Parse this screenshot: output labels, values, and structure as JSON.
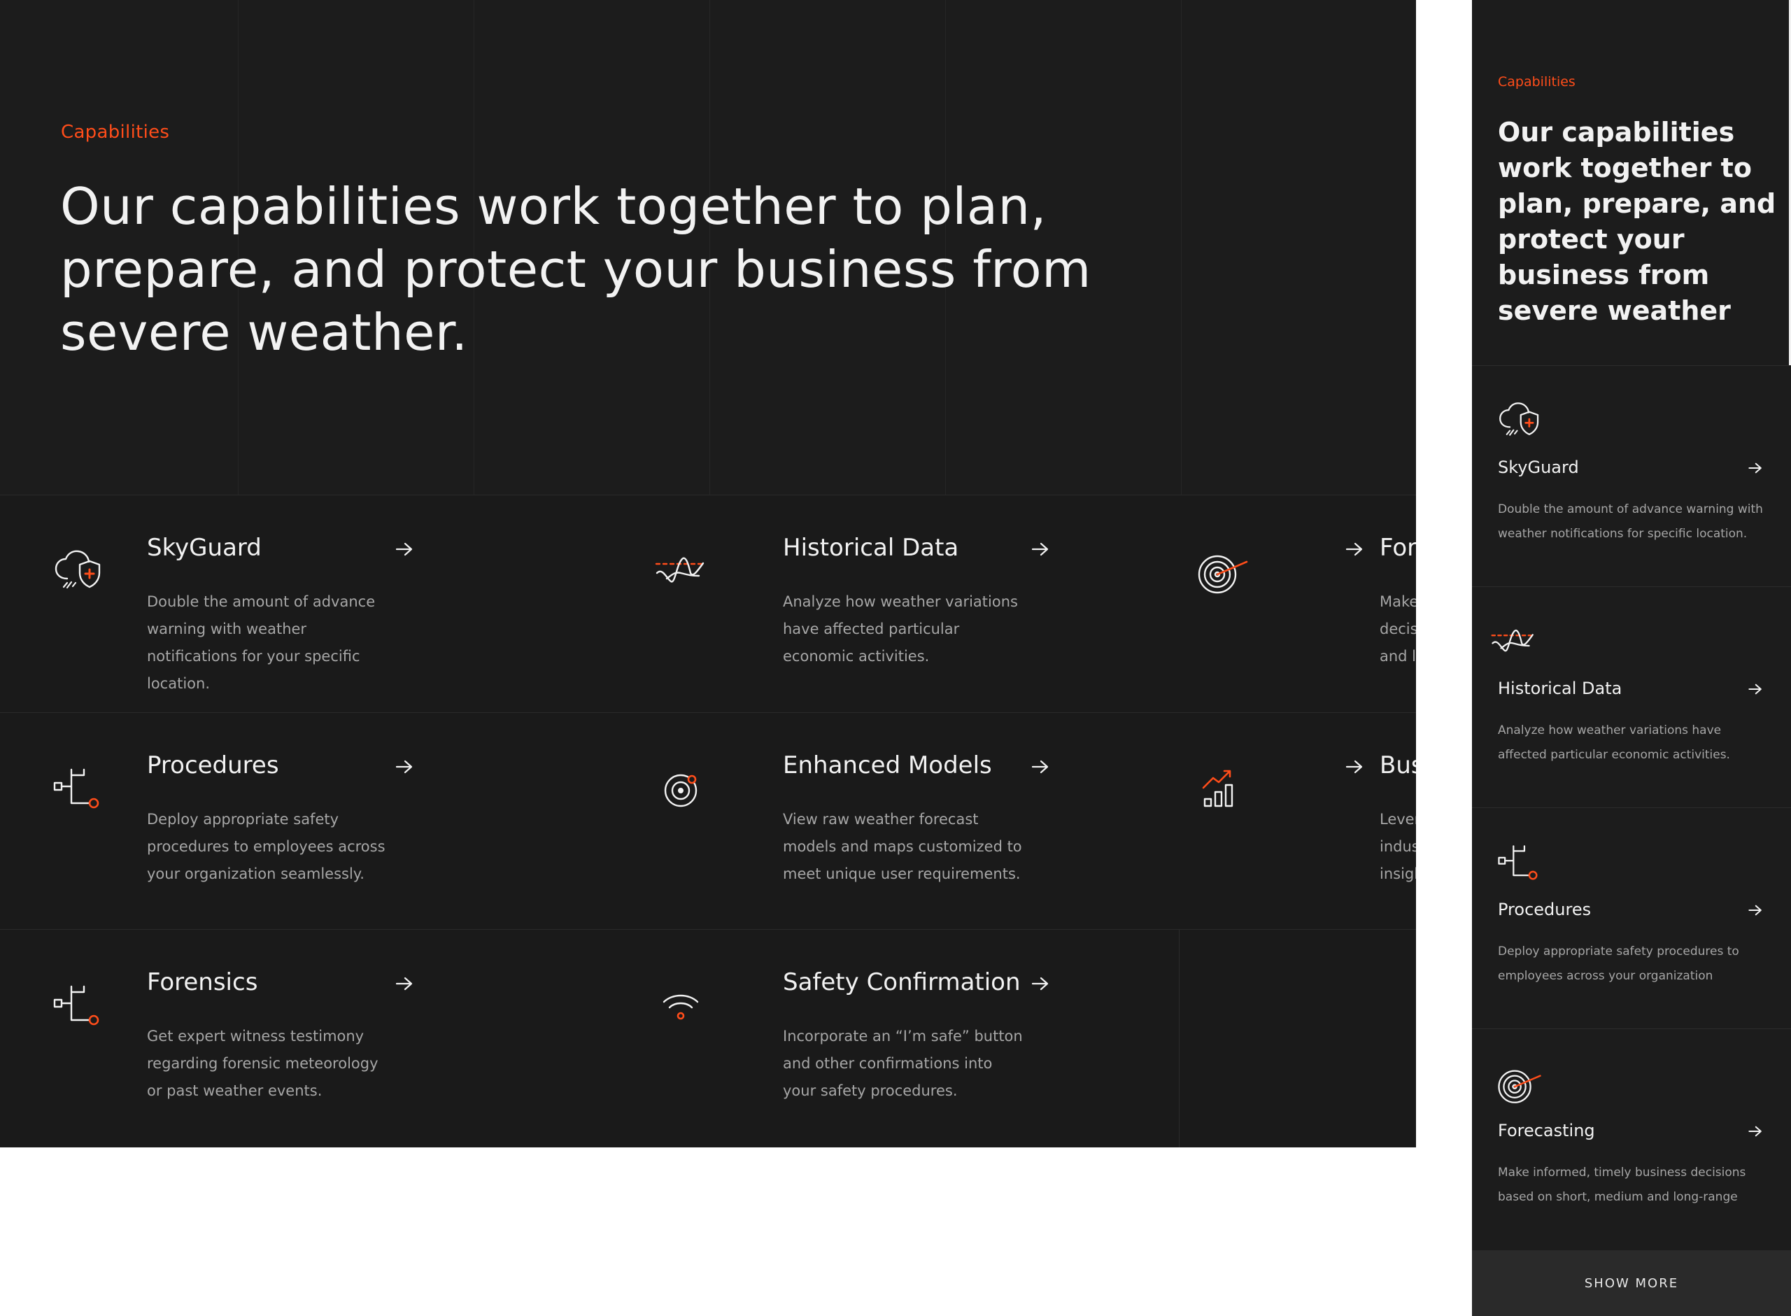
{
  "colors": {
    "accent": "#ff4d1a",
    "background": "#1a1a1a",
    "text": "#f2f2f2",
    "muted": "#a6a6a6"
  },
  "desktop": {
    "eyebrow": "Capabilities",
    "headline": "Our capabilities work together to plan, prepare, and protect your business from severe weather.",
    "cards": [
      {
        "icon": "skyguard-icon",
        "title": "SkyGuard",
        "desc": "Double the amount of advance warning with weather notifications for your specific location."
      },
      {
        "icon": "historical-data-icon",
        "title": "Historical Data",
        "desc": "Analyze how weather variations have affected particular economic activities."
      },
      {
        "icon": "forecasting-icon",
        "title": "Forecasting",
        "desc": "Make informed, timely business decisions based on short, medium and long-range forecasts."
      },
      {
        "icon": "procedures-icon",
        "title": "Procedures",
        "desc": "Deploy appropriate safety procedures to employees across your organization seamlessly."
      },
      {
        "icon": "enhanced-models-icon",
        "title": "Enhanced Models",
        "desc": "View raw weather forecast models and maps customized to meet unique user requirements."
      },
      {
        "icon": "business-analytics-icon",
        "title": "Business Analytics",
        "desc": "Leverage predictive analytics and industry data to get industry-specific insights."
      },
      {
        "icon": "forensics-icon",
        "title": "Forensics",
        "desc": "Get expert witness testimony regarding forensic meteorology or past weather events."
      },
      {
        "icon": "safety-confirmation-icon",
        "title": "Safety Confirmation",
        "desc": "Incorporate an “I’m safe” button and other confirmations into your safety procedures."
      }
    ]
  },
  "mobile": {
    "eyebrow": "Capabilities",
    "headline": "Our capabilities work together to plan, prepare, and protect your business from severe weather",
    "cards": [
      {
        "icon": "skyguard-icon",
        "title": "SkyGuard",
        "desc": "Double the amount of advance warning with weather notifications for specific location."
      },
      {
        "icon": "historical-data-icon",
        "title": "Historical Data",
        "desc": "Analyze how weather variations have affected particular economic activities."
      },
      {
        "icon": "procedures-icon",
        "title": "Procedures",
        "desc": "Deploy appropriate safety procedures to employees across your organization"
      },
      {
        "icon": "forecasting-icon",
        "title": "Forecasting",
        "desc": "Make informed, timely business decisions based on short, medium and long-range"
      }
    ],
    "show_more": "SHOW MORE"
  }
}
